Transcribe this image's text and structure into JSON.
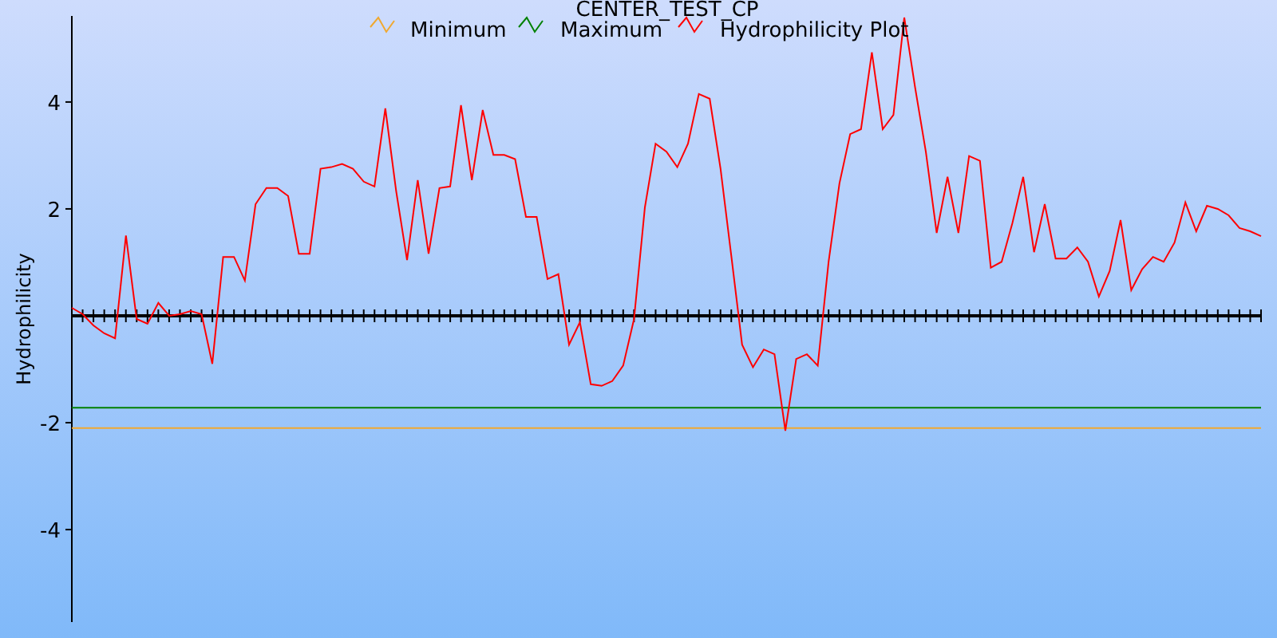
{
  "chart_data": {
    "type": "line",
    "title": "CENTER_TEST_CP",
    "ylabel": "Hydrophilicity",
    "ylim": [
      -5.73,
      5.61
    ],
    "yticks": [
      -4,
      -2,
      2,
      4
    ],
    "legend": true,
    "series": [
      {
        "name": "Minimum",
        "color": "#f0a830",
        "values": [
          -2.1,
          -2.1,
          -2.1,
          -2.1,
          -2.1,
          -2.1,
          -2.1,
          -2.1,
          -2.1,
          -2.1,
          -2.1,
          -2.1,
          -2.1,
          -2.1,
          -2.1,
          -2.1,
          -2.1,
          -2.1,
          -2.1,
          -2.1,
          -2.1,
          -2.1,
          -2.1,
          -2.1,
          -2.1,
          -2.1,
          -2.1,
          -2.1,
          -2.1,
          -2.1,
          -2.1,
          -2.1,
          -2.1,
          -2.1,
          -2.1,
          -2.1,
          -2.1,
          -2.1,
          -2.1,
          -2.1,
          -2.1,
          -2.1,
          -2.1,
          -2.1,
          -2.1,
          -2.1,
          -2.1,
          -2.1,
          -2.1,
          -2.1,
          -2.1,
          -2.1,
          -2.1,
          -2.1,
          -2.1,
          -2.1,
          -2.1,
          -2.1,
          -2.1,
          -2.1,
          -2.1,
          -2.1,
          -2.1,
          -2.1,
          -2.1,
          -2.1,
          -2.1,
          -2.1,
          -2.1,
          -2.1,
          -2.1,
          -2.1,
          -2.1,
          -2.1,
          -2.1,
          -2.1,
          -2.1,
          -2.1,
          -2.1,
          -2.1,
          -2.1,
          -2.1,
          -2.1,
          -2.1,
          -2.1,
          -2.1,
          -2.1,
          -2.1,
          -2.1,
          -2.1,
          -2.1,
          -2.1,
          -2.1,
          -2.1,
          -2.1,
          -2.1,
          -2.1,
          -2.1,
          -2.1,
          -2.1,
          -2.1,
          -2.1,
          -2.1,
          -2.1,
          -2.1,
          -2.1,
          -2.1,
          -2.1,
          -2.1,
          -2.1,
          -2.1
        ]
      },
      {
        "name": "Maximum",
        "color": "#008000",
        "values": [
          -1.72,
          -1.72,
          -1.72,
          -1.72,
          -1.72,
          -1.72,
          -1.72,
          -1.72,
          -1.72,
          -1.72,
          -1.72,
          -1.72,
          -1.72,
          -1.72,
          -1.72,
          -1.72,
          -1.72,
          -1.72,
          -1.72,
          -1.72,
          -1.72,
          -1.72,
          -1.72,
          -1.72,
          -1.72,
          -1.72,
          -1.72,
          -1.72,
          -1.72,
          -1.72,
          -1.72,
          -1.72,
          -1.72,
          -1.72,
          -1.72,
          -1.72,
          -1.72,
          -1.72,
          -1.72,
          -1.72,
          -1.72,
          -1.72,
          -1.72,
          -1.72,
          -1.72,
          -1.72,
          -1.72,
          -1.72,
          -1.72,
          -1.72,
          -1.72,
          -1.72,
          -1.72,
          -1.72,
          -1.72,
          -1.72,
          -1.72,
          -1.72,
          -1.72,
          -1.72,
          -1.72,
          -1.72,
          -1.72,
          -1.72,
          -1.72,
          -1.72,
          -1.72,
          -1.72,
          -1.72,
          -1.72,
          -1.72,
          -1.72,
          -1.72,
          -1.72,
          -1.72,
          -1.72,
          -1.72,
          -1.72,
          -1.72,
          -1.72,
          -1.72,
          -1.72,
          -1.72,
          -1.72,
          -1.72,
          -1.72,
          -1.72,
          -1.72,
          -1.72,
          -1.72,
          -1.72,
          -1.72,
          -1.72,
          -1.72,
          -1.72,
          -1.72,
          -1.72,
          -1.72,
          -1.72,
          -1.72,
          -1.72,
          -1.72,
          -1.72,
          -1.72,
          -1.72,
          -1.72,
          -1.72,
          -1.72,
          -1.72,
          -1.72,
          -1.72
        ]
      },
      {
        "name": "Hydrophilicity Plot",
        "color": "#ff0000",
        "values": [
          0.15,
          0.03,
          -0.18,
          -0.33,
          -0.42,
          1.5,
          -0.06,
          -0.15,
          0.24,
          0,
          0.03,
          0.09,
          0.03,
          -0.9,
          1.1,
          1.1,
          0.66,
          2.09,
          2.39,
          2.39,
          2.24,
          1.16,
          1.16,
          2.75,
          2.78,
          2.84,
          2.75,
          2.51,
          2.42,
          3.88,
          2.33,
          1.04,
          2.54,
          1.16,
          2.39,
          2.42,
          3.94,
          2.54,
          3.85,
          3.01,
          3.01,
          2.93,
          1.85,
          1.85,
          0.69,
          0.78,
          -0.54,
          -0.12,
          -1.28,
          -1.31,
          -1.22,
          -0.93,
          -0.06,
          2.03,
          3.22,
          3.07,
          2.78,
          3.22,
          4.15,
          4.06,
          2.75,
          1.13,
          -0.54,
          -0.96,
          -0.63,
          -0.72,
          -2.15,
          -0.81,
          -0.72,
          -0.93,
          1.01,
          2.48,
          3.4,
          3.49,
          4.93,
          3.49,
          3.76,
          5.58,
          4.27,
          3.07,
          1.55,
          2.6,
          1.55,
          2.99,
          2.9,
          0.9,
          1.01,
          1.73,
          2.6,
          1.19,
          2.09,
          1.07,
          1.07,
          1.28,
          1.01,
          0.36,
          0.84,
          1.79,
          0.48,
          0.87,
          1.1,
          1.01,
          1.37,
          2.12,
          1.58,
          2.06,
          2.0,
          1.88,
          1.64,
          1.58,
          1.49
        ]
      }
    ]
  }
}
